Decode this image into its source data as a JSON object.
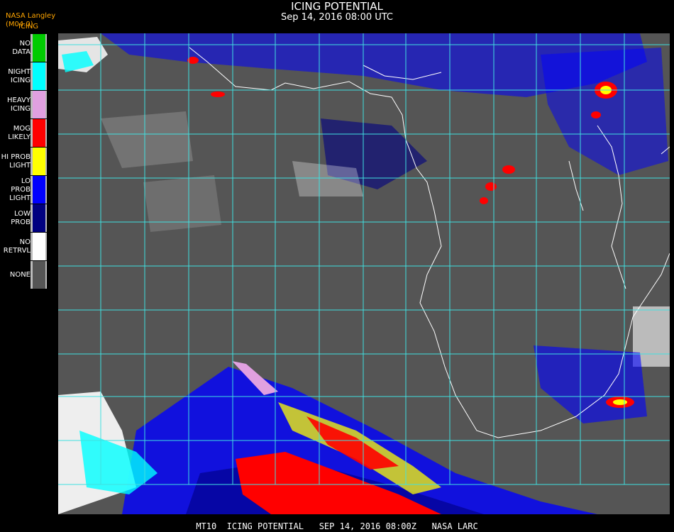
{
  "header": {
    "title": "ICING POTENTIAL",
    "subtitle": "Sep 14, 2016 08:00 UTC",
    "source": "NASA Langley (M04.0)",
    "product": "ICING"
  },
  "legend": [
    {
      "label": "NO DATA",
      "color": "#00cc00"
    },
    {
      "label": "NIGHT\nICING",
      "color": "#00ffff"
    },
    {
      "label": "HEAVY\nICING",
      "color": "#e0a0e0"
    },
    {
      "label": "MOG\nLIKELY",
      "color": "#ff0000"
    },
    {
      "label": "HI PROB\nLIGHT",
      "color": "#ffff00"
    },
    {
      "label": "LO PROB\nLIGHT",
      "color": "#0000ff"
    },
    {
      "label": "LOW\nPROB",
      "color": "#000080"
    },
    {
      "label": "NO\nRETRVL",
      "color": "#ffffff"
    },
    {
      "label": "NONE",
      "color": "#555555"
    }
  ],
  "colors": {
    "background": "#555555",
    "grid": "#40e0e0",
    "grid_label": "#cc3333",
    "boundary": "#ffffff"
  },
  "footer": "MT10  ICING POTENTIAL   SEP 14, 2016 08:00Z   NASA LARC"
}
